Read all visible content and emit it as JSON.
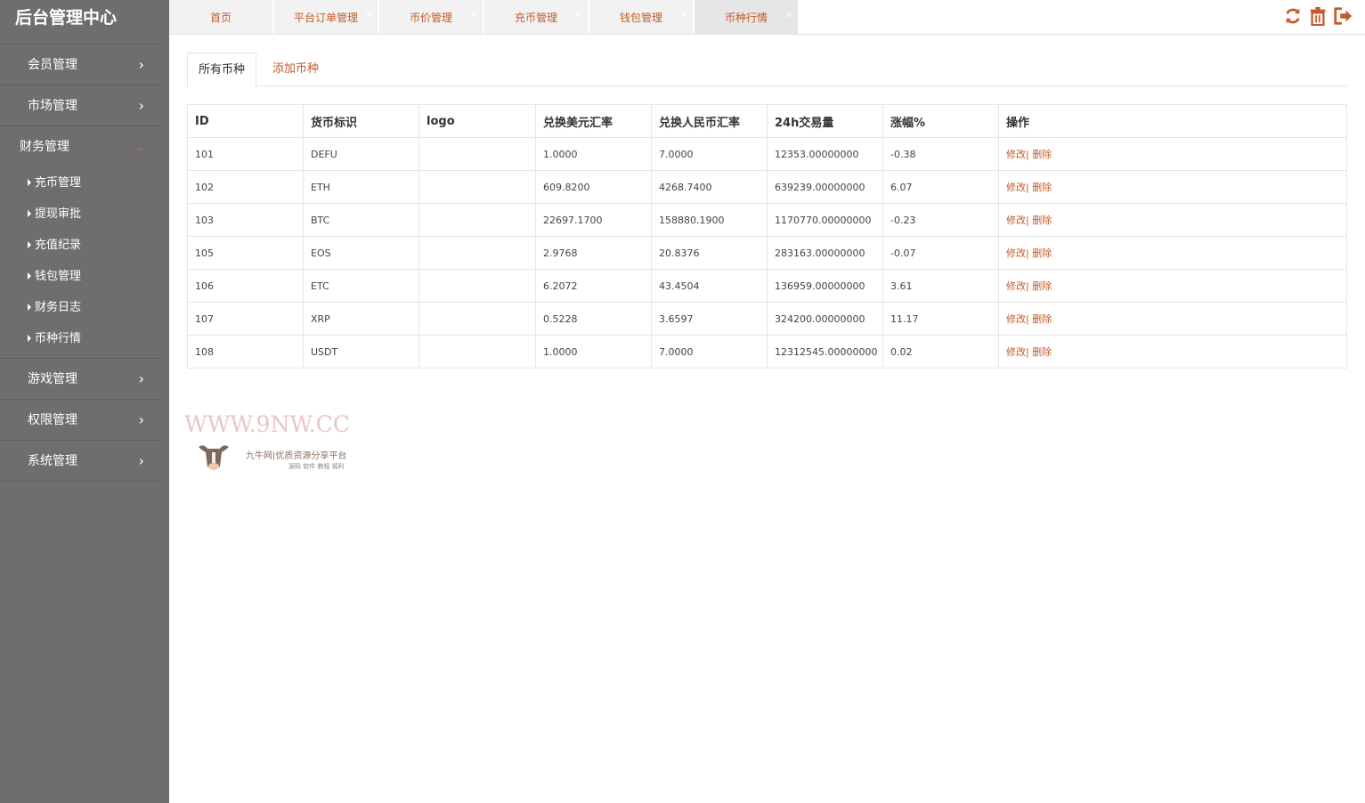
{
  "sidebar": {
    "brand": "后台管理中心",
    "menu": {
      "member": "会员管理",
      "market": "市场管理",
      "finance": "财务管理",
      "game": "游戏管理",
      "permission": "权限管理",
      "system": "系统管理"
    },
    "finance_sub": [
      "充币管理",
      "提现审批",
      "充值纪录",
      "钱包管理",
      "财务日志",
      "币种行情"
    ]
  },
  "tabs": [
    "首页",
    "平台订单管理",
    "币价管理",
    "充币管理",
    "钱包管理",
    "币种行情"
  ],
  "active_tab": "币种行情",
  "subtabs": {
    "all": "所有币种",
    "add": "添加币种"
  },
  "table": {
    "headers": [
      "ID",
      "货币标识",
      "logo",
      "兑换美元汇率",
      "兑换人民币汇率",
      "24h交易量",
      "涨幅%",
      "操作"
    ],
    "rows": [
      [
        "101",
        "DEFU",
        "",
        "1.0000",
        "7.0000",
        "12353.00000000",
        "-0.38"
      ],
      [
        "102",
        "ETH",
        "",
        "609.8200",
        "4268.7400",
        "639239.00000000",
        "6.07"
      ],
      [
        "103",
        "BTC",
        "",
        "22697.1700",
        "158880.1900",
        "1170770.00000000",
        "-0.23"
      ],
      [
        "105",
        "EOS",
        "",
        "2.9768",
        "20.8376",
        "283163.00000000",
        "-0.07"
      ],
      [
        "106",
        "ETC",
        "",
        "6.2072",
        "43.4504",
        "136959.00000000",
        "3.61"
      ],
      [
        "107",
        "XRP",
        "",
        "0.5228",
        "3.6597",
        "324200.00000000",
        "11.17"
      ],
      [
        "108",
        "USDT",
        "",
        "1.0000",
        "7.0000",
        "12312545.00000000",
        "0.02"
      ]
    ],
    "edit_label": "修改",
    "separator": "|",
    "delete_label": "删除"
  },
  "watermark": {
    "title": "WWW.9NW.CC",
    "subtitle": "九牛网|优质资源分享平台",
    "tags": "源码 软件 教程 福利"
  },
  "colors": {
    "sidebar": "#6e6e6e",
    "accent": "#c55a2b"
  }
}
